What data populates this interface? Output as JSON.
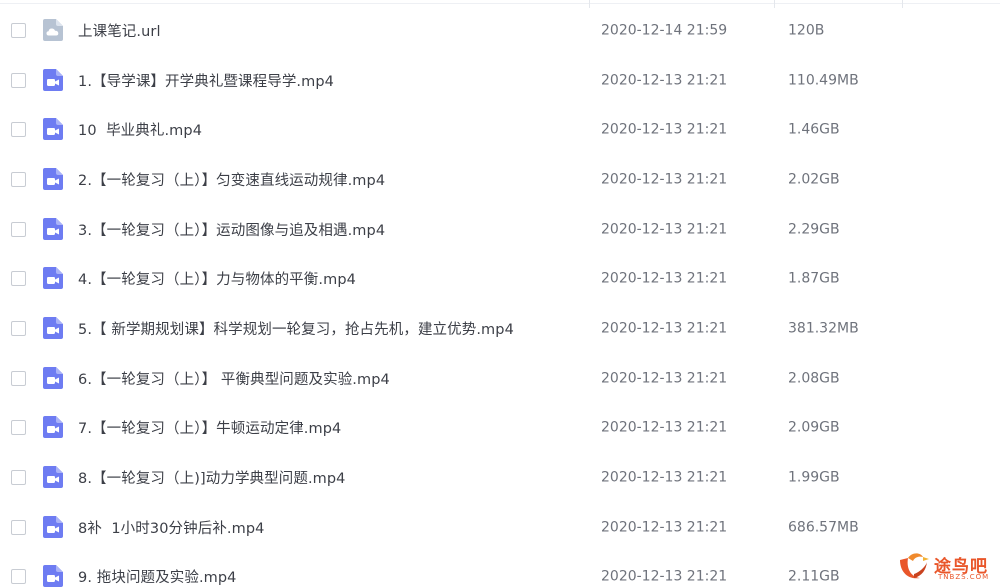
{
  "colors": {
    "video_icon": "#6e7cf2",
    "link_icon": "#b7c3d3",
    "text": "#3c3f47",
    "meta_text": "#6f737c",
    "watermark": "#e9562a"
  },
  "files": [
    {
      "icon": "link-file-icon",
      "name": "上课笔记.url",
      "date": "2020-12-14 21:59",
      "size": "120B"
    },
    {
      "icon": "video-file-icon",
      "name": "1.【导学课】开学典礼暨课程导学.mp4",
      "date": "2020-12-13 21:21",
      "size": "110.49MB"
    },
    {
      "icon": "video-file-icon",
      "name": "10  毕业典礼.mp4",
      "date": "2020-12-13 21:21",
      "size": "1.46GB"
    },
    {
      "icon": "video-file-icon",
      "name": "2.【一轮复习（上）】匀变速直线运动规律.mp4",
      "date": "2020-12-13 21:21",
      "size": "2.02GB"
    },
    {
      "icon": "video-file-icon",
      "name": "3.【一轮复习（上）】运动图像与追及相遇.mp4",
      "date": "2020-12-13 21:21",
      "size": "2.29GB"
    },
    {
      "icon": "video-file-icon",
      "name": "4.【一轮复习（上）】力与物体的平衡.mp4",
      "date": "2020-12-13 21:21",
      "size": "1.87GB"
    },
    {
      "icon": "video-file-icon",
      "name": "5.【 新学期规划课】科学规划一轮复习，抢占先机，建立优势.mp4",
      "date": "2020-12-13 21:21",
      "size": "381.32MB"
    },
    {
      "icon": "video-file-icon",
      "name": "6.【一轮复习（上）】 平衡典型问题及实验.mp4",
      "date": "2020-12-13 21:21",
      "size": "2.08GB"
    },
    {
      "icon": "video-file-icon",
      "name": "7.【一轮复习（上）】牛顿运动定律.mp4",
      "date": "2020-12-13 21:21",
      "size": "2.09GB"
    },
    {
      "icon": "video-file-icon",
      "name": "8.【一轮复习（上)]动力学典型问题.mp4",
      "date": "2020-12-13 21:21",
      "size": "1.99GB"
    },
    {
      "icon": "video-file-icon",
      "name": "8补  1小时30分钟后补.mp4",
      "date": "2020-12-13 21:21",
      "size": "686.57MB"
    },
    {
      "icon": "video-file-icon",
      "name": "9. 拖块问题及实验.mp4",
      "date": "2020-12-13 21:21",
      "size": "2.11GB"
    }
  ],
  "watermark": {
    "title": "途鸟吧",
    "url": "TNBZS.COM"
  }
}
